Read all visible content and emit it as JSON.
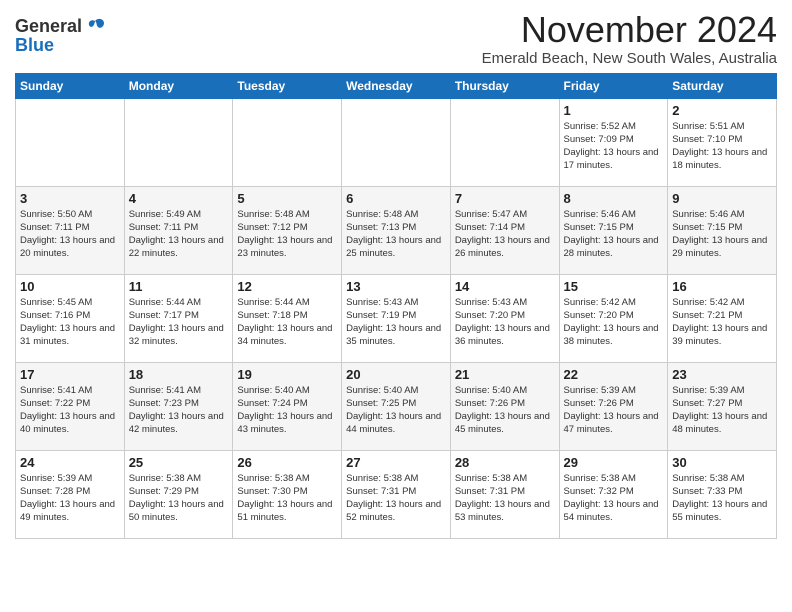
{
  "logo": {
    "general": "General",
    "blue": "Blue"
  },
  "title": "November 2024",
  "subtitle": "Emerald Beach, New South Wales, Australia",
  "weekdays": [
    "Sunday",
    "Monday",
    "Tuesday",
    "Wednesday",
    "Thursday",
    "Friday",
    "Saturday"
  ],
  "weeks": [
    [
      {
        "day": "",
        "info": ""
      },
      {
        "day": "",
        "info": ""
      },
      {
        "day": "",
        "info": ""
      },
      {
        "day": "",
        "info": ""
      },
      {
        "day": "",
        "info": ""
      },
      {
        "day": "1",
        "info": "Sunrise: 5:52 AM\nSunset: 7:09 PM\nDaylight: 13 hours and 17 minutes."
      },
      {
        "day": "2",
        "info": "Sunrise: 5:51 AM\nSunset: 7:10 PM\nDaylight: 13 hours and 18 minutes."
      }
    ],
    [
      {
        "day": "3",
        "info": "Sunrise: 5:50 AM\nSunset: 7:11 PM\nDaylight: 13 hours and 20 minutes."
      },
      {
        "day": "4",
        "info": "Sunrise: 5:49 AM\nSunset: 7:11 PM\nDaylight: 13 hours and 22 minutes."
      },
      {
        "day": "5",
        "info": "Sunrise: 5:48 AM\nSunset: 7:12 PM\nDaylight: 13 hours and 23 minutes."
      },
      {
        "day": "6",
        "info": "Sunrise: 5:48 AM\nSunset: 7:13 PM\nDaylight: 13 hours and 25 minutes."
      },
      {
        "day": "7",
        "info": "Sunrise: 5:47 AM\nSunset: 7:14 PM\nDaylight: 13 hours and 26 minutes."
      },
      {
        "day": "8",
        "info": "Sunrise: 5:46 AM\nSunset: 7:15 PM\nDaylight: 13 hours and 28 minutes."
      },
      {
        "day": "9",
        "info": "Sunrise: 5:46 AM\nSunset: 7:15 PM\nDaylight: 13 hours and 29 minutes."
      }
    ],
    [
      {
        "day": "10",
        "info": "Sunrise: 5:45 AM\nSunset: 7:16 PM\nDaylight: 13 hours and 31 minutes."
      },
      {
        "day": "11",
        "info": "Sunrise: 5:44 AM\nSunset: 7:17 PM\nDaylight: 13 hours and 32 minutes."
      },
      {
        "day": "12",
        "info": "Sunrise: 5:44 AM\nSunset: 7:18 PM\nDaylight: 13 hours and 34 minutes."
      },
      {
        "day": "13",
        "info": "Sunrise: 5:43 AM\nSunset: 7:19 PM\nDaylight: 13 hours and 35 minutes."
      },
      {
        "day": "14",
        "info": "Sunrise: 5:43 AM\nSunset: 7:20 PM\nDaylight: 13 hours and 36 minutes."
      },
      {
        "day": "15",
        "info": "Sunrise: 5:42 AM\nSunset: 7:20 PM\nDaylight: 13 hours and 38 minutes."
      },
      {
        "day": "16",
        "info": "Sunrise: 5:42 AM\nSunset: 7:21 PM\nDaylight: 13 hours and 39 minutes."
      }
    ],
    [
      {
        "day": "17",
        "info": "Sunrise: 5:41 AM\nSunset: 7:22 PM\nDaylight: 13 hours and 40 minutes."
      },
      {
        "day": "18",
        "info": "Sunrise: 5:41 AM\nSunset: 7:23 PM\nDaylight: 13 hours and 42 minutes."
      },
      {
        "day": "19",
        "info": "Sunrise: 5:40 AM\nSunset: 7:24 PM\nDaylight: 13 hours and 43 minutes."
      },
      {
        "day": "20",
        "info": "Sunrise: 5:40 AM\nSunset: 7:25 PM\nDaylight: 13 hours and 44 minutes."
      },
      {
        "day": "21",
        "info": "Sunrise: 5:40 AM\nSunset: 7:26 PM\nDaylight: 13 hours and 45 minutes."
      },
      {
        "day": "22",
        "info": "Sunrise: 5:39 AM\nSunset: 7:26 PM\nDaylight: 13 hours and 47 minutes."
      },
      {
        "day": "23",
        "info": "Sunrise: 5:39 AM\nSunset: 7:27 PM\nDaylight: 13 hours and 48 minutes."
      }
    ],
    [
      {
        "day": "24",
        "info": "Sunrise: 5:39 AM\nSunset: 7:28 PM\nDaylight: 13 hours and 49 minutes."
      },
      {
        "day": "25",
        "info": "Sunrise: 5:38 AM\nSunset: 7:29 PM\nDaylight: 13 hours and 50 minutes."
      },
      {
        "day": "26",
        "info": "Sunrise: 5:38 AM\nSunset: 7:30 PM\nDaylight: 13 hours and 51 minutes."
      },
      {
        "day": "27",
        "info": "Sunrise: 5:38 AM\nSunset: 7:31 PM\nDaylight: 13 hours and 52 minutes."
      },
      {
        "day": "28",
        "info": "Sunrise: 5:38 AM\nSunset: 7:31 PM\nDaylight: 13 hours and 53 minutes."
      },
      {
        "day": "29",
        "info": "Sunrise: 5:38 AM\nSunset: 7:32 PM\nDaylight: 13 hours and 54 minutes."
      },
      {
        "day": "30",
        "info": "Sunrise: 5:38 AM\nSunset: 7:33 PM\nDaylight: 13 hours and 55 minutes."
      }
    ]
  ]
}
